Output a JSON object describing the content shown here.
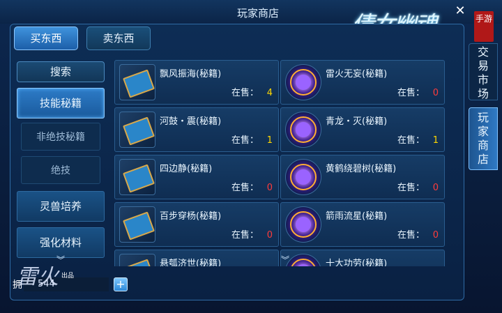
{
  "title": "玩家商店",
  "logo_text": "倩女幽魂",
  "close_icon": "close-icon",
  "badge": "手游",
  "top_tabs": {
    "buy": "买东西",
    "sell": "卖东西"
  },
  "sidebar": {
    "search": "搜索",
    "categories": [
      "技能秘籍",
      "非绝技秘籍",
      "绝技",
      "灵兽培养",
      "强化材料"
    ]
  },
  "stock_label": "在售：",
  "items": [
    {
      "name": "飘风振海(秘籍)",
      "count": "4",
      "icon": "book"
    },
    {
      "name": "雷火无妄(秘籍)",
      "count": "0",
      "icon": "orb"
    },
    {
      "name": "河鼓・震(秘籍)",
      "count": "1",
      "icon": "book"
    },
    {
      "name": "青龙・灭(秘籍)",
      "count": "1",
      "icon": "orb"
    },
    {
      "name": "四边静(秘籍)",
      "count": "0",
      "icon": "book"
    },
    {
      "name": "黄鹤绕碧树(秘籍)",
      "count": "0",
      "icon": "orb"
    },
    {
      "name": "百步穿杨(秘籍)",
      "count": "0",
      "icon": "book"
    },
    {
      "name": "箭雨流星(秘籍)",
      "count": "0",
      "icon": "orb"
    },
    {
      "name": "悬瓠济世(秘籍)",
      "count": "",
      "icon": "book"
    },
    {
      "name": "十大功劳(秘籍)",
      "count": "",
      "icon": "orb"
    }
  ],
  "bottom": {
    "label": "拥",
    "value": "544",
    "watermark": "雷火",
    "watermark_small": "出品"
  },
  "side_tabs": {
    "market": "交易市场",
    "player_shop": "玩家商店"
  },
  "colors": {
    "accent": "#3f93dd",
    "count_positive": "#ffd700",
    "count_zero": "#ff3b3b"
  }
}
